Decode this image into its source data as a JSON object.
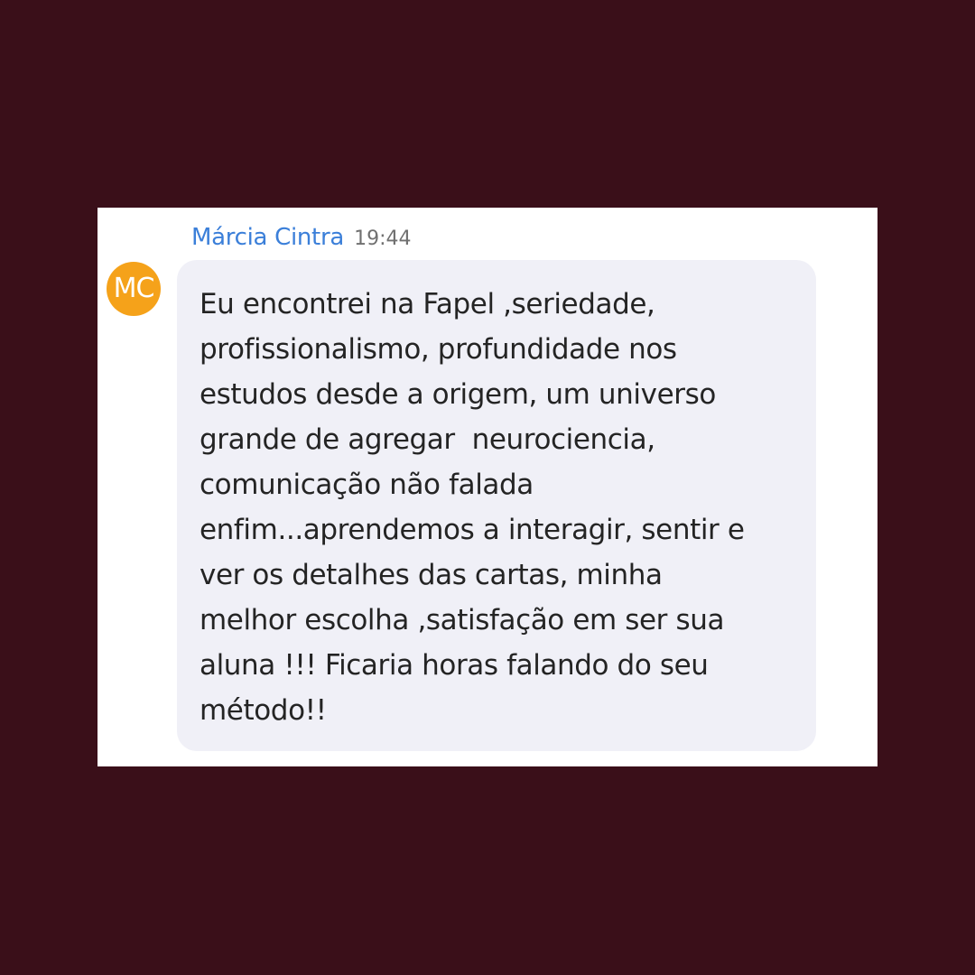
{
  "message": {
    "sender_name": "Márcia Cintra",
    "timestamp": "19:44",
    "avatar_initials": "MC",
    "text": "Eu encontrei na Fapel ,seriedade,\nprofissionalismo, profundidade nos\nestudos desde a origem, um universo\ngrande de agregar  neurociencia,\ncomunicação não falada\nenfim...aprendemos a interagir, sentir e\nver os detalhes das cartas, minha\nmelhor escolha ,satisfação em ser sua\naluna !!! Ficaria horas falando do seu\nmétodo!!"
  },
  "colors": {
    "page_background": "#3a0f19",
    "card_background": "#ffffff",
    "sender_name": "#3b7fd9",
    "avatar": "#f5a21a",
    "bubble": "#f0f0f7"
  }
}
